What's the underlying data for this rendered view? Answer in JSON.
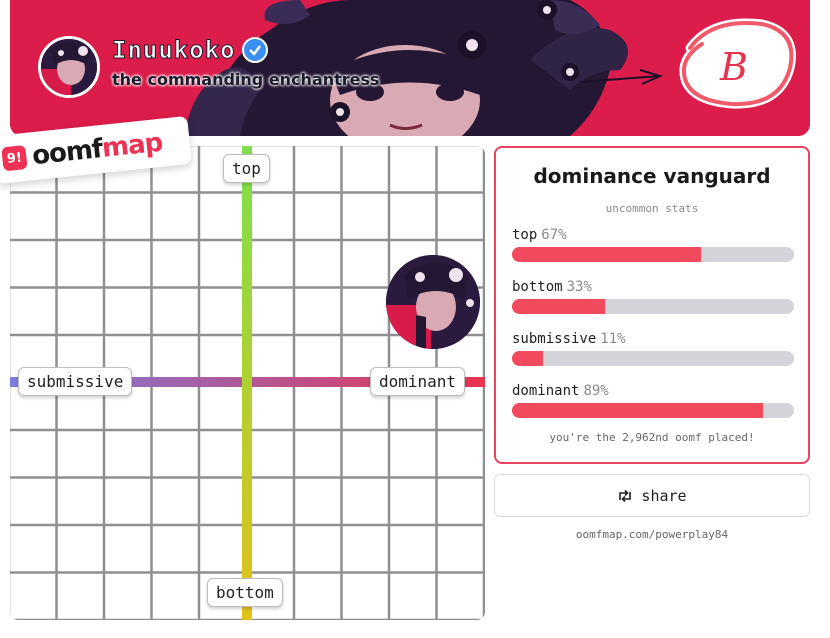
{
  "profile": {
    "name": "Inuukoko",
    "subtitle": "the commanding enchantress",
    "verified_icon": "verified-check-icon",
    "badge_letter": "B"
  },
  "logo": {
    "part1": "oomf",
    "part2": "map",
    "pin_text": "9!"
  },
  "chart": {
    "axes": {
      "top": "top",
      "bottom": "bottom",
      "left": "submissive",
      "right": "dominant"
    },
    "marker": {
      "dominance": 0.89,
      "top": 0.67
    },
    "colors": {
      "vertical_top": "#7de04a",
      "vertical_bottom": "#e3c11a",
      "horizontal_left": "#7a7de0",
      "horizontal_right": "#e8334f",
      "grid": "#8f8f8f"
    }
  },
  "card": {
    "title": "dominance vanguard",
    "subtitle": "uncommon stats",
    "stats": [
      {
        "label": "top",
        "pct_text": "67%",
        "value": 67
      },
      {
        "label": "bottom",
        "pct_text": "33%",
        "value": 33
      },
      {
        "label": "submissive",
        "pct_text": "11%",
        "value": 11
      },
      {
        "label": "dominant",
        "pct_text": "89%",
        "value": 89
      }
    ],
    "footer": "you're the 2,962nd oomf placed!",
    "border_color": "#e84360",
    "bar_color": "#f14a5d"
  },
  "share": {
    "label": "share",
    "icon": "repost-icon"
  },
  "url": "oomfmap.com/powerplay84"
}
